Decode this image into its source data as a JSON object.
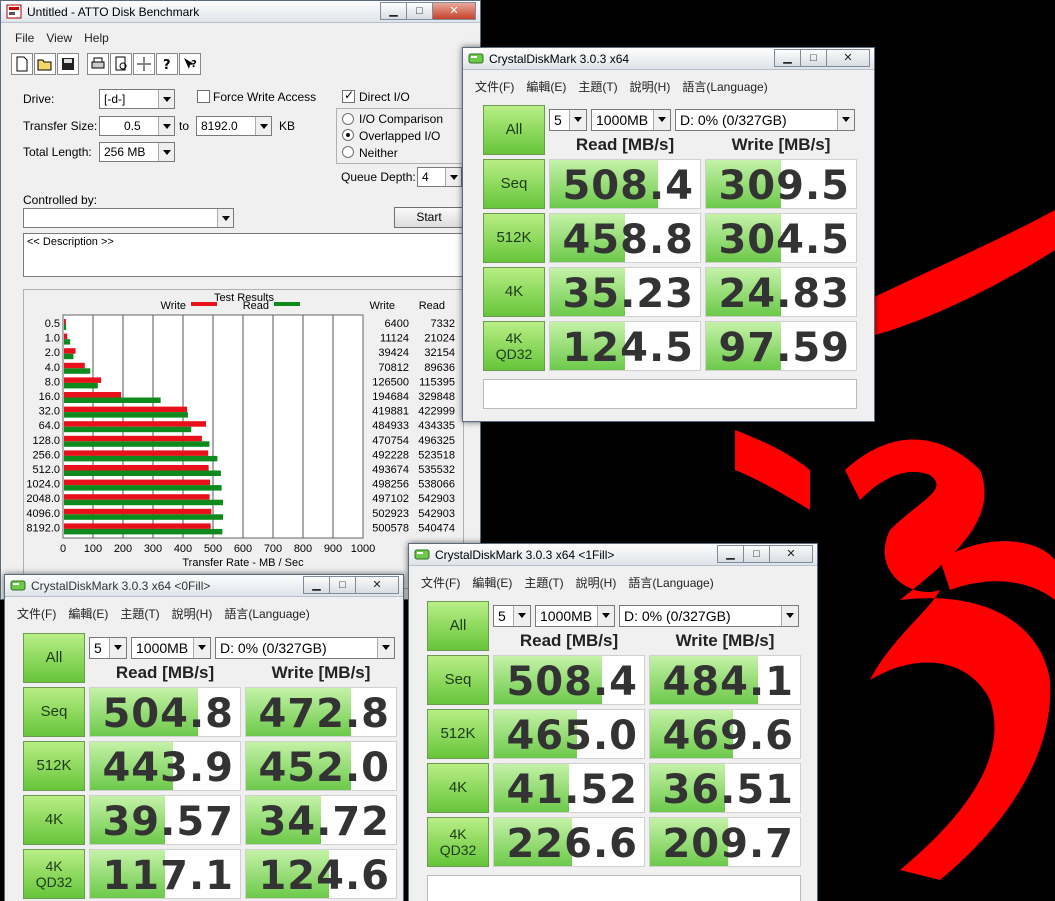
{
  "colors": {
    "read_bar": "#0d8a1b",
    "write_bar": "#e8101a",
    "cdm_green": "#6cc94a",
    "desktop_red": "#ff0000"
  },
  "atto": {
    "title": "Untitled - ATTO Disk Benchmark",
    "menu": [
      "File",
      "View",
      "Help"
    ],
    "toolbar_icons": [
      "new-icon",
      "open-icon",
      "save-icon",
      "print-icon",
      "print-preview-icon",
      "move-icon",
      "help-icon",
      "context-help-icon"
    ],
    "drive_label": "Drive:",
    "drive_value": "[-d-]",
    "force_write_label": "Force Write Access",
    "direct_io_label": "Direct I/O",
    "transfer_size_label": "Transfer Size:",
    "transfer_from": "0.5",
    "to_label": "to",
    "transfer_to": "8192.0",
    "kb_label": "KB",
    "total_length_label": "Total Length:",
    "total_length_value": "256 MB",
    "io_comparison_label": "I/O Comparison",
    "overlapped_io_label": "Overlapped I/O",
    "neither_label": "Neither",
    "queue_depth_label": "Queue Depth:",
    "queue_depth_value": "4",
    "controlled_by_label": "Controlled by:",
    "start_label": "Start",
    "description_text": "<< Description >>",
    "results_title": "Test Results"
  },
  "chart_data": {
    "type": "bar",
    "orientation": "horizontal",
    "title": "Test Results",
    "xlabel": "Transfer Rate - MB / Sec",
    "xlim": [
      0,
      1000
    ],
    "xticks": [
      0,
      100,
      200,
      300,
      400,
      500,
      600,
      700,
      800,
      900,
      1000
    ],
    "legend": [
      "Write",
      "Read"
    ],
    "table_headers": [
      "Write",
      "Read"
    ],
    "categories": [
      "0.5",
      "1.0",
      "2.0",
      "4.0",
      "8.0",
      "16.0",
      "32.0",
      "64.0",
      "128.0",
      "256.0",
      "512.0",
      "1024.0",
      "2048.0",
      "4096.0",
      "8192.0"
    ],
    "series": [
      {
        "name": "Write",
        "values": [
          6400,
          11124,
          39424,
          70812,
          126500,
          194684,
          419881,
          484933,
          470754,
          492228,
          493674,
          498256,
          497102,
          502923,
          500578
        ]
      },
      {
        "name": "Read",
        "values": [
          7332,
          21024,
          32154,
          89636,
          115395,
          329848,
          422999,
          434335,
          496325,
          523518,
          535532,
          538066,
          542903,
          542903,
          540474
        ]
      }
    ]
  },
  "cdm_common": {
    "menu": [
      "文件(F)",
      "編輯(E)",
      "主題(T)",
      "說明(H)",
      "語言(Language)"
    ],
    "all_label": "All",
    "runs": "5",
    "size": "1000MB",
    "drive": "D: 0% (0/327GB)",
    "read_header": "Read [MB/s]",
    "write_header": "Write [MB/s]",
    "row_labels": [
      "Seq",
      "512K",
      "4K",
      "4K QD32"
    ],
    "row_label_top": [
      "",
      "",
      "",
      "4K"
    ],
    "row_label_bottom": [
      "",
      "",
      "",
      "QD32"
    ]
  },
  "cdm1": {
    "title": "CrystalDiskMark 3.0.3 x64",
    "read": [
      "508.4",
      "458.8",
      "35.23",
      "124.5"
    ],
    "write": [
      "309.5",
      "304.5",
      "24.83",
      "97.59"
    ],
    "read_fill": [
      0.72,
      0.5,
      0.5,
      0.5
    ],
    "write_fill": [
      0.5,
      0.5,
      0.5,
      0.5
    ]
  },
  "cdm2": {
    "title": "CrystalDiskMark 3.0.3 x64 <0Fill>",
    "read": [
      "504.8",
      "443.9",
      "39.57",
      "117.1"
    ],
    "write": [
      "472.8",
      "452.0",
      "34.72",
      "124.6"
    ],
    "read_fill": [
      0.72,
      0.55,
      0.5,
      0.5
    ],
    "write_fill": [
      0.7,
      0.7,
      0.5,
      0.55
    ]
  },
  "cdm3": {
    "title": "CrystalDiskMark 3.0.3 x64 <1Fill>",
    "read": [
      "508.4",
      "465.0",
      "41.52",
      "226.6"
    ],
    "write": [
      "484.1",
      "469.6",
      "36.51",
      "209.7"
    ],
    "read_fill": [
      0.72,
      0.55,
      0.5,
      0.52
    ],
    "write_fill": [
      0.72,
      0.55,
      0.5,
      0.52
    ]
  }
}
